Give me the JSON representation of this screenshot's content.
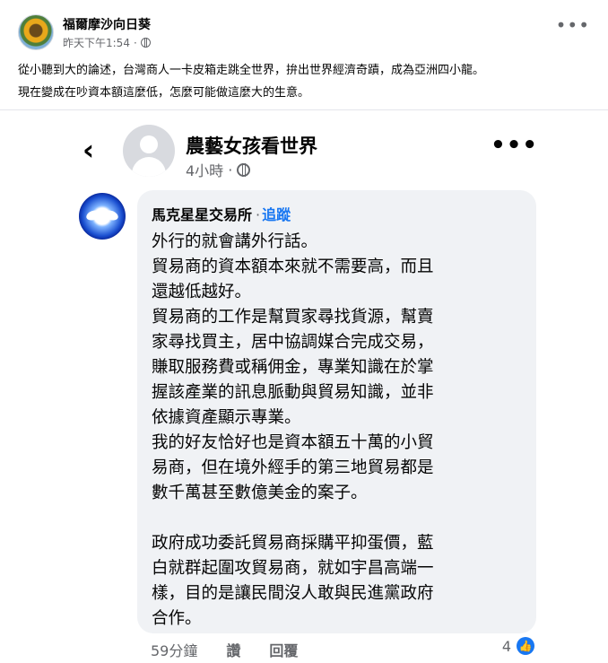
{
  "post": {
    "author": "福爾摩沙向日葵",
    "timestamp": "昨天下午1:54",
    "privacy_icon": "globe-icon",
    "more_icon": "more-icon",
    "text_lines": [
      "從小聽到大的論述，台灣商人一卡皮箱走跳全世界，拚出世界經濟奇蹟，成為亞洲四小龍。",
      "現在變成在吵資本額這麼低，怎麼可能做這麼大的生意。"
    ]
  },
  "screenshot": {
    "back_icon": "‹",
    "page_name": "農藝女孩看世界",
    "time": "4小時",
    "comment": {
      "author": "馬克星星交易所",
      "separator": "·",
      "follow_label": "追蹤",
      "lines": [
        "外行的就會講外行話。",
        "貿易商的資本額本來就不需要高，而且",
        "還越低越好。",
        "貿易商的工作是幫買家尋找貨源，幫賣",
        "家尋找買主，居中協調媒合完成交易，",
        "賺取服務費或稱佣金，專業知識在於掌",
        "握該產業的訊息脈動與貿易知識，並非",
        "依據資產顯示專業。",
        "我的好友恰好也是資本額五十萬的小貿",
        "易商，但在境外經手的第三地貿易都是",
        "數千萬甚至數億美金的案子。",
        "",
        "政府成功委託貿易商採購平抑蛋價，藍",
        "白就群起圍攻貿易商，就如宇昌高端一",
        "樣，目的是讓民間沒人敢與民進黨政府",
        "合作。"
      ],
      "time": "59分鐘",
      "like_label": "讚",
      "reply_label": "回覆",
      "reaction_count": "4"
    }
  },
  "colors": {
    "accent": "#1877f2",
    "bubble": "#f0f2f5",
    "muted": "#65676b"
  }
}
